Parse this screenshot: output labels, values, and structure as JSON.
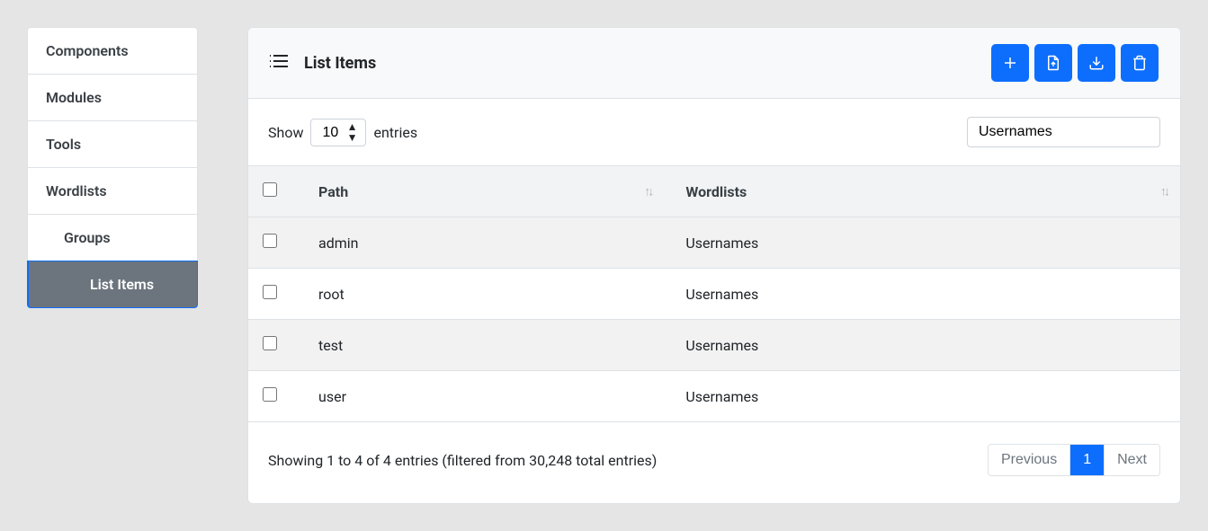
{
  "sidebar": {
    "items": [
      {
        "label": "Components",
        "sub": false,
        "active": false
      },
      {
        "label": "Modules",
        "sub": false,
        "active": false
      },
      {
        "label": "Tools",
        "sub": false,
        "active": false
      },
      {
        "label": "Wordlists",
        "sub": false,
        "active": false
      },
      {
        "label": "Groups",
        "sub": true,
        "active": false
      },
      {
        "label": "List Items",
        "sub": true,
        "active": true
      }
    ]
  },
  "header": {
    "title": "List Items"
  },
  "toolbar": {
    "add_label": "Add",
    "export_label": "Export",
    "download_label": "Download",
    "delete_label": "Delete"
  },
  "controls": {
    "show_label": "Show",
    "entries_label": "entries",
    "page_size": "10",
    "search_value": "Usernames"
  },
  "table": {
    "columns": {
      "path": "Path",
      "wordlists": "Wordlists"
    },
    "rows": [
      {
        "path": "admin",
        "wordlists": "Usernames"
      },
      {
        "path": "root",
        "wordlists": "Usernames"
      },
      {
        "path": "test",
        "wordlists": "Usernames"
      },
      {
        "path": "user",
        "wordlists": "Usernames"
      }
    ]
  },
  "footer": {
    "info": "Showing 1 to 4 of 4 entries (filtered from 30,248 total entries)",
    "prev_label": "Previous",
    "page_label": "1",
    "next_label": "Next"
  }
}
